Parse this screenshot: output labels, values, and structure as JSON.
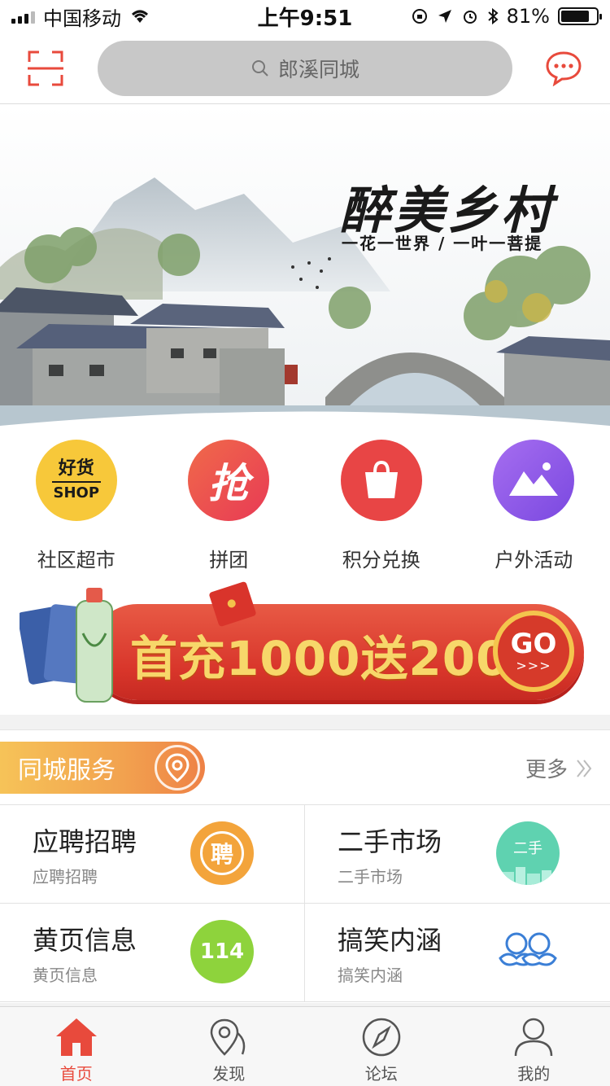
{
  "status_bar": {
    "carrier": "中国移动",
    "time": "上午9:51",
    "battery": "81%",
    "battery_level": 0.81
  },
  "header": {
    "search_placeholder": "郎溪同城",
    "icons": {
      "scan": "scan-icon",
      "message": "chat-bubble-icon",
      "search": "search-icon"
    }
  },
  "banner": {
    "title": "醉美乡村",
    "subtitle": "一花一世界 / 一叶一菩提"
  },
  "categories": [
    {
      "label": "社区超市",
      "icon_top": "好货",
      "icon_bottom": "SHOP",
      "color": "#f7c83a"
    },
    {
      "label": "拼团",
      "icon_char": "抢",
      "color": "#ef4a4a"
    },
    {
      "label": "积分兑换",
      "icon": "shopping-bag-icon",
      "color": "#e84545"
    },
    {
      "label": "户外活动",
      "icon": "mountain-icon",
      "color": "#8c55e6"
    }
  ],
  "promo": {
    "text": "首充1000送200",
    "go": "GO",
    "arrows": ">>>"
  },
  "service": {
    "title": "同城服务",
    "more": "更多",
    "items": [
      {
        "title": "应聘招聘",
        "subtitle": "应聘招聘",
        "icon_char": "聘",
        "color": "#f3a43b"
      },
      {
        "title": "二手市场",
        "subtitle": "二手市场",
        "icon_char": "二手",
        "color": "#5fd2b0"
      },
      {
        "title": "黄页信息",
        "subtitle": "黄页信息",
        "icon_char": "114",
        "color": "#8ed33c"
      },
      {
        "title": "搞笑内涵",
        "subtitle": "搞笑内涵",
        "icon": "mustache-faces-icon",
        "color": "#3b7fd6"
      }
    ]
  },
  "tabbar": [
    {
      "label": "首页",
      "icon": "home-icon",
      "active": true
    },
    {
      "label": "发现",
      "icon": "map-pin-icon",
      "active": false
    },
    {
      "label": "论坛",
      "icon": "compass-icon",
      "active": false
    },
    {
      "label": "我的",
      "icon": "user-icon",
      "active": false
    }
  ],
  "colors": {
    "accent": "#e84a3c",
    "tag_orange": "#f2a24f",
    "promo_red": "#d8352a",
    "promo_gold": "#f7d76a"
  }
}
